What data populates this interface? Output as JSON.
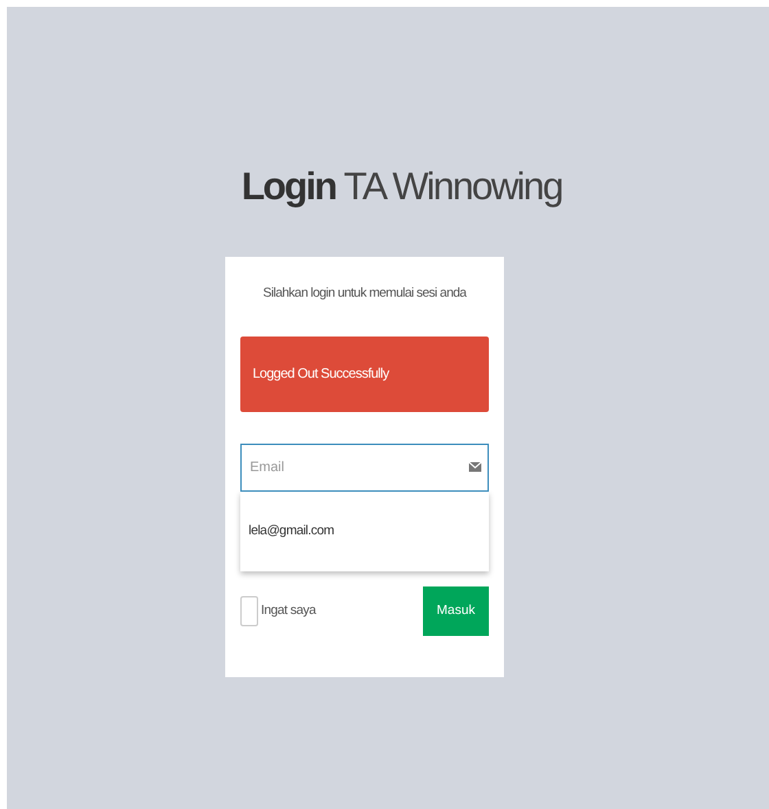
{
  "title": "**Login** TA Winnowing",
  "subtitle": "Silahkan login untuk memulai sesi anda",
  "alert": {
    "text": "Logged Out Successfully"
  },
  "email_field": {
    "placeholder": "Email",
    "focused": true
  },
  "suggestions": [
    "lela@gmail.com"
  ],
  "remember": {
    "label": "Ingat saya",
    "checked": false
  },
  "submit": "Masuk"
}
